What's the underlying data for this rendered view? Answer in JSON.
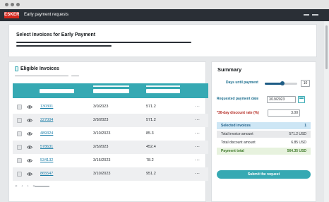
{
  "window": {
    "title": "Early payment requests",
    "logo": "ESKER"
  },
  "header": {
    "title": "Select Invoices for Early Payment"
  },
  "invoices": {
    "title": "Eligible Invoices",
    "rows": [
      {
        "id": "130301",
        "date": "3/0/2023",
        "amount": "571.2",
        "menu": "..."
      },
      {
        "id": "227004",
        "date": "2/9/2023",
        "amount": "571.2",
        "menu": "..."
      },
      {
        "id": "489324",
        "date": "3/10/2023",
        "amount": "85.3",
        "menu": "..."
      },
      {
        "id": "578631",
        "date": "2/5/2023",
        "amount": "452.4",
        "menu": "..."
      },
      {
        "id": "534132",
        "date": "3/16/2023",
        "amount": "78.2",
        "menu": "..."
      },
      {
        "id": "865547",
        "date": "3/10/2023",
        "amount": "951.2",
        "menu": "..."
      }
    ],
    "pager": "« ‹ › »"
  },
  "summary": {
    "title": "Summary",
    "days_label": "Days until payment",
    "days_value": "10",
    "days_slider_fraction": 0.55,
    "date_label": "Requested payment date",
    "date_value": "3/19/2023",
    "rate_label": "*30-day discount rate (%)",
    "rate_value": "3.00",
    "selected_label": "Selected invoices",
    "selected_value": "1",
    "total_label": "Total invoice amount",
    "total_value": "571.2 USD",
    "discount_label": "Total discount amount",
    "discount_value": "6.85 USD",
    "payment_label": "Payment total",
    "payment_value": "564.35 USD",
    "submit_label": "Submit the request"
  },
  "colors": {
    "accent": "#36a9b3",
    "brand": "#d4261c",
    "link": "#1d7fa8"
  },
  "icons": {
    "eye": "eye-icon",
    "calendar": "calendar-icon",
    "document": "document-icon"
  }
}
